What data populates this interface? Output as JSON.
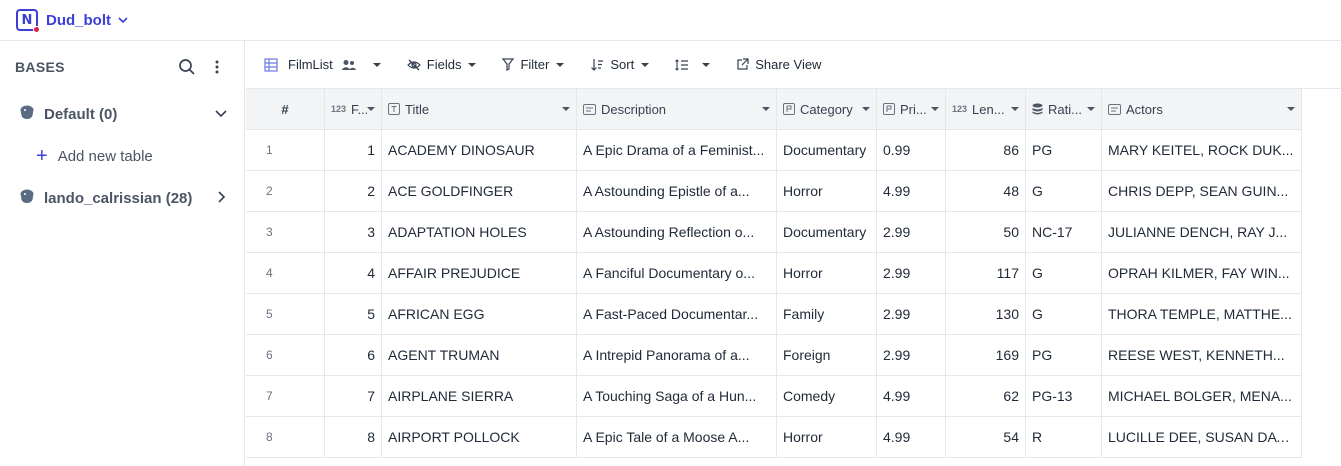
{
  "project": {
    "name": "Dud_bolt",
    "logo_letter": "N"
  },
  "sidebar": {
    "title": "BASES",
    "bases": [
      {
        "label": "Default (0)",
        "expanded": true
      },
      {
        "label": "lando_calrissian (28)",
        "expanded": false
      }
    ],
    "add_table_label": "Add new table"
  },
  "toolbar": {
    "view_name": "FilmList",
    "fields_label": "Fields",
    "filter_label": "Filter",
    "sort_label": "Sort",
    "share_label": "Share View"
  },
  "grid": {
    "columns": [
      {
        "label": "#",
        "icon": ""
      },
      {
        "label": "F...",
        "icon": "number-icon"
      },
      {
        "label": "Title",
        "icon": "text-icon"
      },
      {
        "label": "Description",
        "icon": "longtext-icon"
      },
      {
        "label": "Category",
        "icon": "link-icon"
      },
      {
        "label": "Pri...",
        "icon": "link-icon"
      },
      {
        "label": "Len...",
        "icon": "number-icon"
      },
      {
        "label": "Rati...",
        "icon": "select-icon"
      },
      {
        "label": "Actors",
        "icon": "longtext-icon"
      }
    ],
    "rows": [
      {
        "n": "1",
        "id": "1",
        "title": "ACADEMY DINOSAUR",
        "description": "A Epic Drama of a Feminist...",
        "category": "Documentary",
        "price": "0.99",
        "length": "86",
        "rating": "PG",
        "actors": "MARY KEITEL, ROCK DUK..."
      },
      {
        "n": "2",
        "id": "2",
        "title": "ACE GOLDFINGER",
        "description": "A Astounding Epistle of a...",
        "category": "Horror",
        "price": "4.99",
        "length": "48",
        "rating": "G",
        "actors": "CHRIS DEPP, SEAN GUIN..."
      },
      {
        "n": "3",
        "id": "3",
        "title": "ADAPTATION HOLES",
        "description": "A Astounding Reflection o...",
        "category": "Documentary",
        "price": "2.99",
        "length": "50",
        "rating": "NC-17",
        "actors": "JULIANNE DENCH, RAY J..."
      },
      {
        "n": "4",
        "id": "4",
        "title": "AFFAIR PREJUDICE",
        "description": "A Fanciful Documentary o...",
        "category": "Horror",
        "price": "2.99",
        "length": "117",
        "rating": "G",
        "actors": "OPRAH KILMER, FAY WIN..."
      },
      {
        "n": "5",
        "id": "5",
        "title": "AFRICAN EGG",
        "description": "A Fast-Paced Documentar...",
        "category": "Family",
        "price": "2.99",
        "length": "130",
        "rating": "G",
        "actors": "THORA TEMPLE, MATTHE..."
      },
      {
        "n": "6",
        "id": "6",
        "title": "AGENT TRUMAN",
        "description": "A Intrepid Panorama of a...",
        "category": "Foreign",
        "price": "2.99",
        "length": "169",
        "rating": "PG",
        "actors": "REESE WEST, KENNETH..."
      },
      {
        "n": "7",
        "id": "7",
        "title": "AIRPLANE SIERRA",
        "description": "A Touching Saga of a Hun...",
        "category": "Comedy",
        "price": "4.99",
        "length": "62",
        "rating": "PG-13",
        "actors": "MICHAEL BOLGER, MENA..."
      },
      {
        "n": "8",
        "id": "8",
        "title": "AIRPORT POLLOCK",
        "description": "A Epic Tale of a Moose A...",
        "category": "Horror",
        "price": "4.99",
        "length": "54",
        "rating": "R",
        "actors": "LUCILLE DEE, SUSAN DAV..."
      }
    ]
  }
}
